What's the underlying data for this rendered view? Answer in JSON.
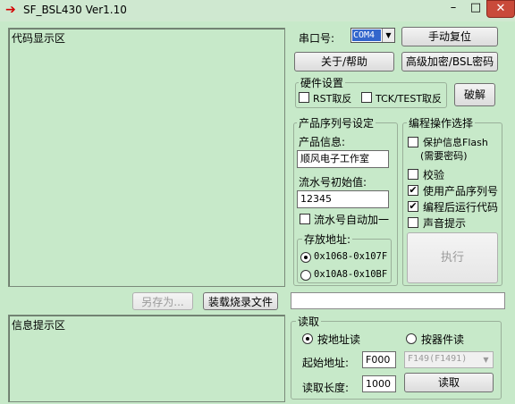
{
  "window": {
    "title": "SF_BSL430 Ver1.10",
    "arrow_glyph": "➔",
    "minimize": "–",
    "maximize": "□",
    "close": "✕"
  },
  "code_area": {
    "label": "代码显示区"
  },
  "info_area": {
    "label": "信息提示区"
  },
  "buttons": {
    "save_as": "另存为...",
    "load_file": "装载烧录文件",
    "reset": "手动复位",
    "about": "关于/帮助",
    "advanced_encrypt": "高级加密/BSL密码",
    "crack": "破解",
    "execute": "执行",
    "read": "读取"
  },
  "serial": {
    "label": "串口号:",
    "value": "COM4"
  },
  "hardware": {
    "legend": "硬件设置",
    "rst_invert": "RST取反",
    "tck_invert": "TCK/TEST取反",
    "rst_checked": false,
    "tck_checked": false
  },
  "serial_setup": {
    "legend": "产品序列号设定",
    "product_info_label": "产品信息:",
    "product_info_value": "顺风电子工作室",
    "serial_start_label": "流水号初始值:",
    "serial_start_value": "12345",
    "auto_increment_label": "流水号自动加一",
    "auto_increment_checked": false,
    "storage_legend": "存放地址:",
    "addr_option_1": "0x1068-0x107F",
    "addr_option_2": "0x10A8-0x10BF",
    "addr_selected": 1
  },
  "programming": {
    "legend": "编程操作选择",
    "protect_flash": "保护信息Flash",
    "protect_flash_note": "(需要密码)",
    "verify": "校验",
    "use_serial": "使用产品序列号",
    "run_after": "编程后运行代码",
    "sound": "声音提示",
    "checked": {
      "protect_flash": false,
      "verify": false,
      "use_serial": true,
      "run_after": true,
      "sound": false
    }
  },
  "read_section": {
    "legend": "读取",
    "by_address": "按地址读",
    "by_device": "按器件读",
    "selected": "by_address",
    "start_addr_label": "起始地址:",
    "start_addr_value": "F000",
    "device_value": "F149(F1491)",
    "length_label": "读取长度:",
    "length_value": "1000"
  },
  "colors": {
    "background": "#c7e9c9",
    "close_button": "#c94a3a",
    "title_arrow": "#d40000"
  }
}
